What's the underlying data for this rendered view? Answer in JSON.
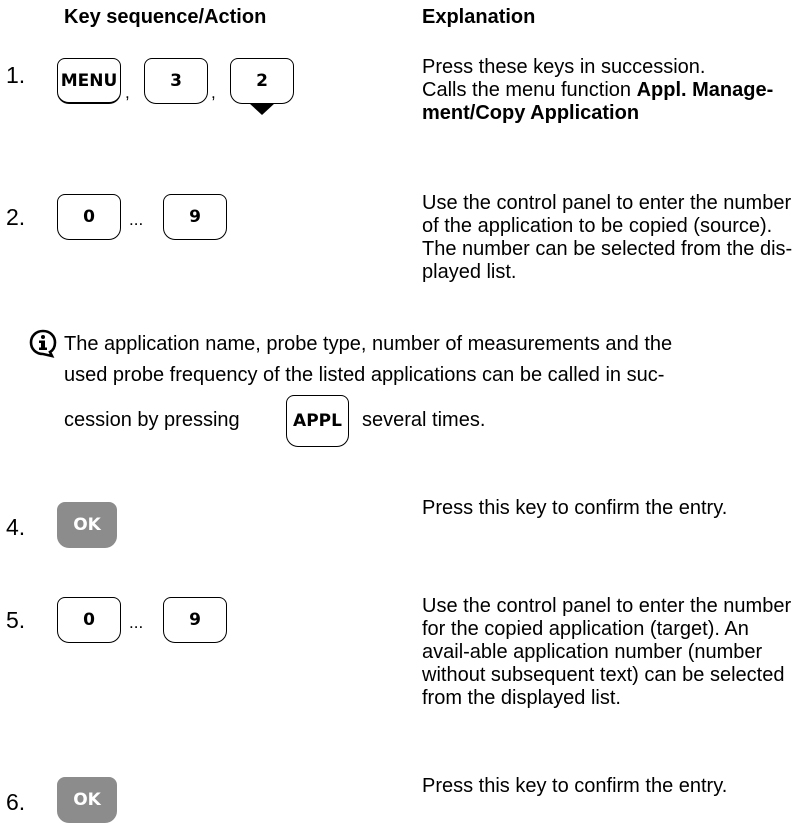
{
  "header": {
    "col1": "Key sequence/Action",
    "col2": "Explanation"
  },
  "steps": [
    {
      "number": "1.",
      "keys": [
        "MENU",
        "3",
        "2"
      ],
      "separators": [
        ",",
        ","
      ],
      "text_plain": "Press these keys in succession.\nCalls the menu function ",
      "text_bold": "Appl. Manage-\nment/Copy Application"
    },
    {
      "number": "2.",
      "keys": [
        "0",
        "9"
      ],
      "separators": [
        "..."
      ],
      "text": "Use the control panel to enter the number of the application to be copied (source). The number can be selected from the dis-played list."
    },
    {
      "number": "4.",
      "keys": [
        "OK"
      ],
      "text": "Press this key to confirm the entry."
    },
    {
      "number": "5.",
      "keys": [
        "0",
        "9"
      ],
      "separators": [
        "..."
      ],
      "text": "Use the control panel to enter the number for the copied application (target). An avail-able application number (number without subsequent text) can be selected from the displayed list."
    },
    {
      "number": "6.",
      "keys": [
        "OK"
      ],
      "text": "Press this key to confirm the entry."
    }
  ],
  "note": {
    "icon": "info-icon",
    "line1": "The application name, probe type, number of measurements and the",
    "line2": "used probe frequency of the listed applications can be called in suc-",
    "line3_before": "cession by pressing",
    "key": "APPL",
    "line3_after": "several times."
  }
}
